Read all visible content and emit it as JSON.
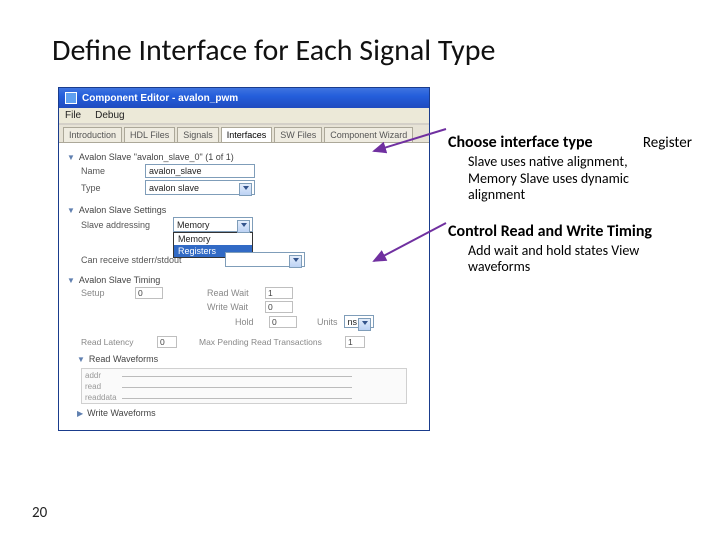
{
  "slide": {
    "title": "Define Interface for Each Signal Type",
    "page_number": "20"
  },
  "window": {
    "title": "Component Editor - avalon_pwm",
    "menu": {
      "file": "File",
      "debug": "Debug"
    },
    "tabs": [
      "Introduction",
      "HDL Files",
      "Signals",
      "Interfaces",
      "SW Files",
      "Component Wizard"
    ],
    "section_label": "Avalon Slave \"avalon_slave_0\" (1 of 1)",
    "name_label": "Name",
    "name_value": "avalon_slave",
    "type_label": "Type",
    "type_value": "avalon slave",
    "settings_label": "Avalon Slave Settings",
    "slave_addr_label": "Slave addressing",
    "slave_addr_value": "Memory",
    "slave_addr_options": [
      "Memory",
      "Registers"
    ],
    "addr_align_label": "Can receive stderr/stdout",
    "timing_label": "Avalon Slave Timing",
    "setup_label": "Setup",
    "setup_value": "0",
    "readwait_label": "Read Wait",
    "readwait_value": "1",
    "hold_label": "Hold",
    "hold_value": "0",
    "writewait_label": "Write Wait",
    "writewait_value": "0",
    "units_label": "Units",
    "units_value": "ns",
    "readlatency_label": "Read Latency",
    "readlatency_value": "0",
    "maxpend_label": "Max Pending Read Transactions",
    "maxpend_value": "1",
    "readwf_label": "Read Waveforms",
    "addr_sig": "addr",
    "read_sig": "read",
    "readdata_sig": "readdata",
    "writewf_label": "Write Waveforms"
  },
  "annotations": {
    "a1_head": "Choose interface type",
    "a1_reg": "Register",
    "a1_body": "Slave uses native alignment, Memory Slave uses dynamic alignment",
    "a2_head": "Control Read and Write Timing",
    "a2_body": "Add wait and hold states View waveforms"
  }
}
